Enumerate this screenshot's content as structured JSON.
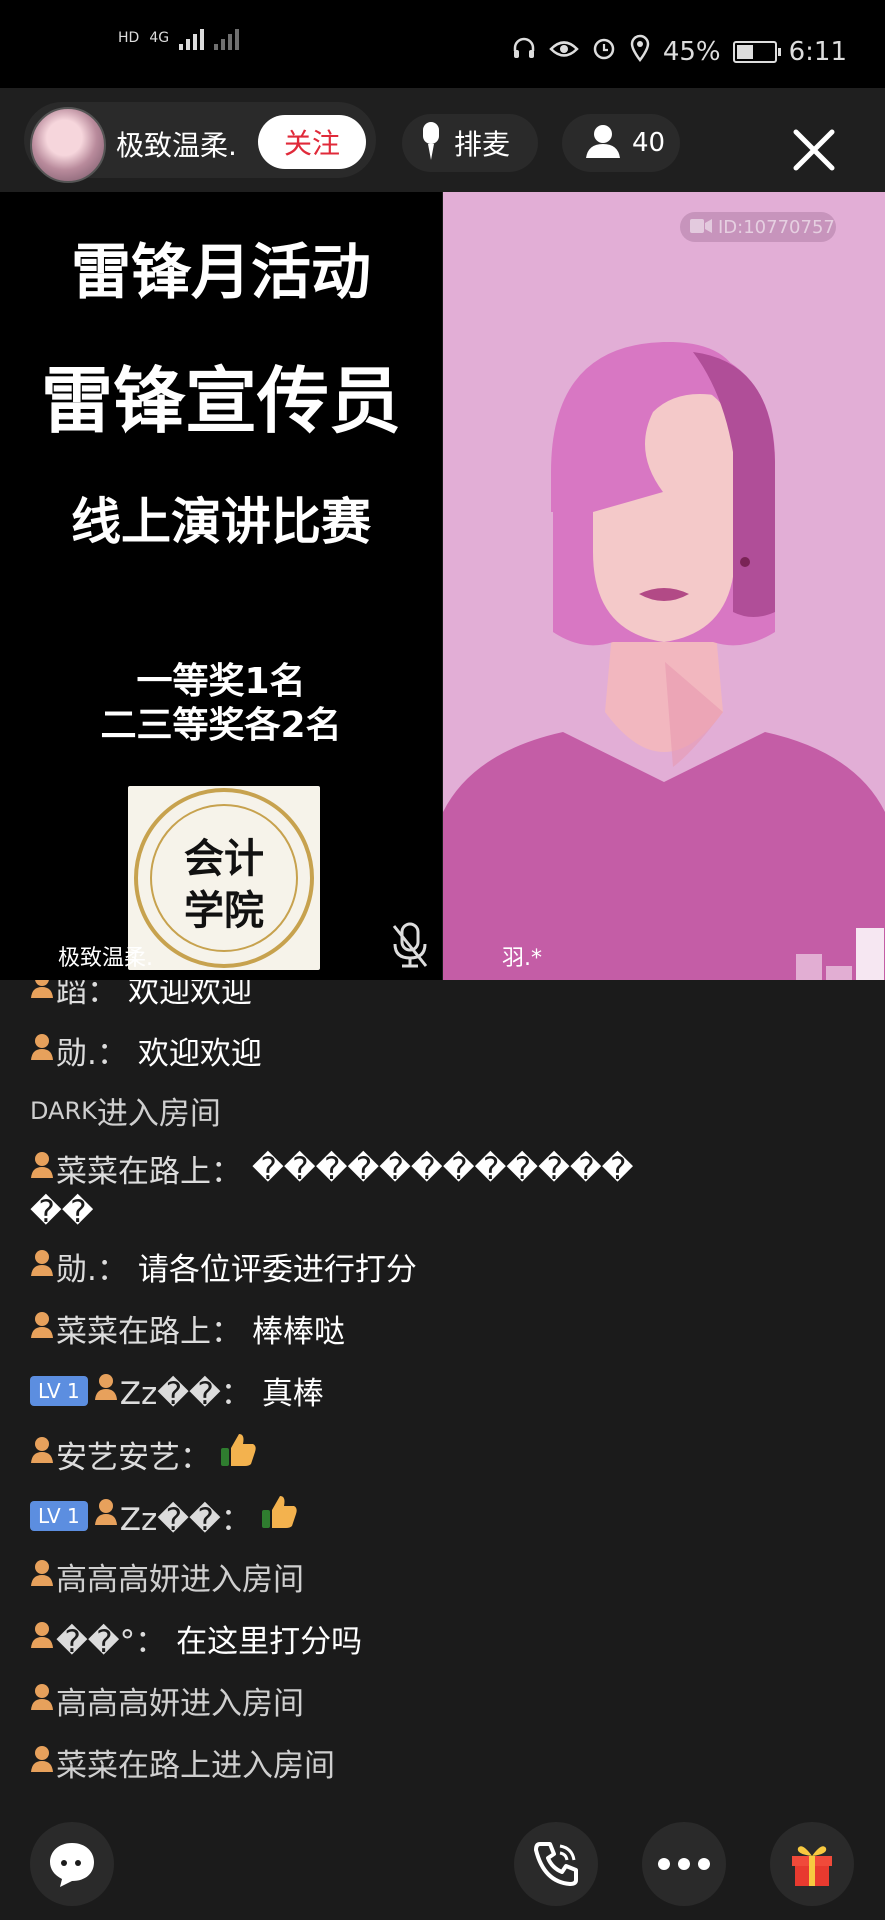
{
  "status_bar": {
    "left_indicators": [
      "HD",
      "4G"
    ],
    "battery": "45%",
    "battery_level": 0.45,
    "time": "6:11"
  },
  "header": {
    "host_name": "极致温柔.",
    "follow_label": "关注",
    "queue_label": "排麦",
    "audience_count": "40"
  },
  "video": {
    "poster_lines": [
      "雷锋月活动",
      "雷锋宣传员",
      "线上演讲比赛",
      "一等奖1名",
      "二三等奖各2名"
    ],
    "seal_text": [
      "会计",
      "学院"
    ],
    "left_name": "极致温柔.",
    "right_name": "羽.*",
    "id_badge": "ID:10770757"
  },
  "chat": {
    "cut_top": {
      "user": "蹈：",
      "text": "欢迎欢迎"
    },
    "messages": [
      {
        "user": "勋.：",
        "text": "欢迎欢迎"
      },
      {
        "system_user": "DARK",
        "text": " 进入房间"
      },
      {
        "user": "菜菜在路上：",
        "text": "������������"
      },
      {
        "continuation": "��"
      },
      {
        "user": "勋.：",
        "text": "请各位评委进行打分"
      },
      {
        "user": "菜菜在路上：",
        "text": "棒棒哒"
      },
      {
        "level": "LV 1",
        "user": "Zz��：",
        "text": "真棒"
      },
      {
        "user": "安艺安艺：",
        "emoji": "thumbs-up"
      },
      {
        "level": "LV 1",
        "user": "Zz��：",
        "emoji": "thumbs-up"
      },
      {
        "user": "高高高妍",
        "text": " 进入房间"
      },
      {
        "user": "��°：",
        "text": "在这里打分吗"
      },
      {
        "user": "高高高妍",
        "text": " 进入房间"
      },
      {
        "user": "菜菜在路上",
        "text": " 进入房间"
      }
    ]
  },
  "bottom_bar": {
    "icons": [
      "chat-bubble-icon",
      "phone-call-icon",
      "more-icon",
      "gift-icon"
    ]
  }
}
